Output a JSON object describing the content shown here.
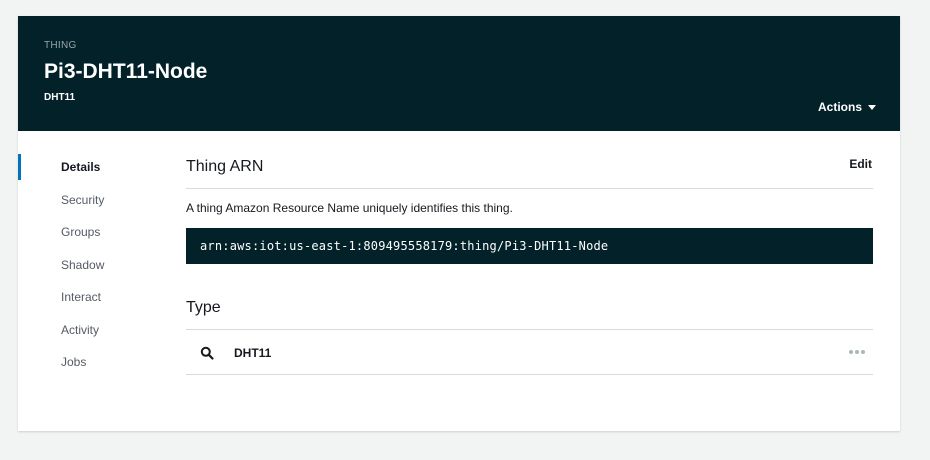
{
  "header": {
    "eyebrow": "THING",
    "title": "Pi3-DHT11-Node",
    "subtitle": "DHT11",
    "actions_label": "Actions"
  },
  "sidebar": {
    "items": [
      {
        "label": "Details",
        "active": true
      },
      {
        "label": "Security"
      },
      {
        "label": "Groups"
      },
      {
        "label": "Shadow"
      },
      {
        "label": "Interact"
      },
      {
        "label": "Activity"
      },
      {
        "label": "Jobs"
      }
    ]
  },
  "arn_section": {
    "title": "Thing ARN",
    "edit_label": "Edit",
    "description": "A thing Amazon Resource Name uniquely identifies this thing.",
    "arn": "arn:aws:iot:us-east-1:809495558179:thing/Pi3-DHT11-Node"
  },
  "type_section": {
    "title": "Type",
    "type_name": "DHT11",
    "icons": {
      "search": "search-icon",
      "more": "more-options-icon"
    }
  },
  "colors": {
    "header_bg": "#022129",
    "active_accent": "#0073bb",
    "page_bg": "#f2f3f3"
  }
}
